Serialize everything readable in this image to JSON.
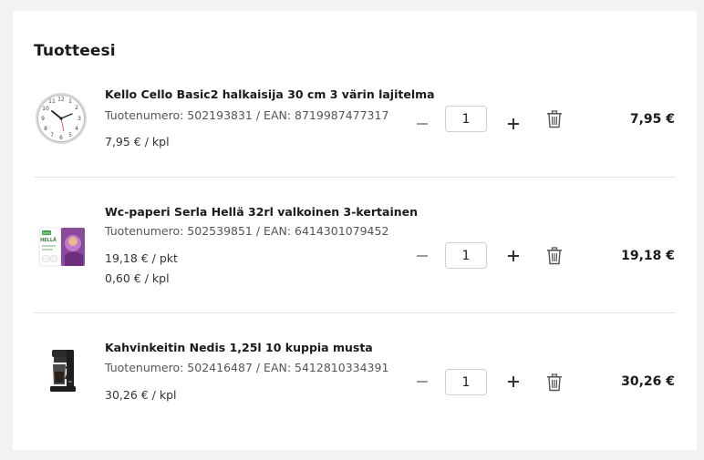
{
  "cart": {
    "title": "Tuotteesi",
    "items": [
      {
        "name": "Kello Cello Basic2 halkaisija 30 cm 3 värin lajitelma",
        "meta": "Tuotenumero: 502193831 / EAN: 8719987477317",
        "unit_prices": [
          "7,95 € / kpl"
        ],
        "quantity": "1",
        "total": "7,95 €",
        "image": "wall-clock"
      },
      {
        "name": "Wc-paperi Serla Hellä 32rl valkoinen 3-kertainen",
        "meta": "Tuotenumero: 502539851 / EAN: 6414301079452",
        "unit_prices": [
          "19,18 € / pkt",
          "0,60 € / kpl"
        ],
        "quantity": "1",
        "total": "19,18 €",
        "image": "toilet-paper-pack",
        "image_brand": "Serla",
        "image_text": "HELLÄ"
      },
      {
        "name": "Kahvinkeitin Nedis 1,25l 10 kuppia musta",
        "meta": "Tuotenumero: 502416487 / EAN: 5412810334391",
        "unit_prices": [
          "30,26 € / kpl"
        ],
        "quantity": "1",
        "total": "30,26 €",
        "image": "coffee-maker"
      }
    ]
  },
  "icons": {
    "decrease": "minus-icon",
    "increase": "plus-icon",
    "remove": "trash-icon"
  },
  "colors": {
    "background": "#f2f2f2",
    "card": "#ffffff",
    "divider": "#e3e3e3",
    "text": "#1a1a1a",
    "muted": "#555555"
  }
}
